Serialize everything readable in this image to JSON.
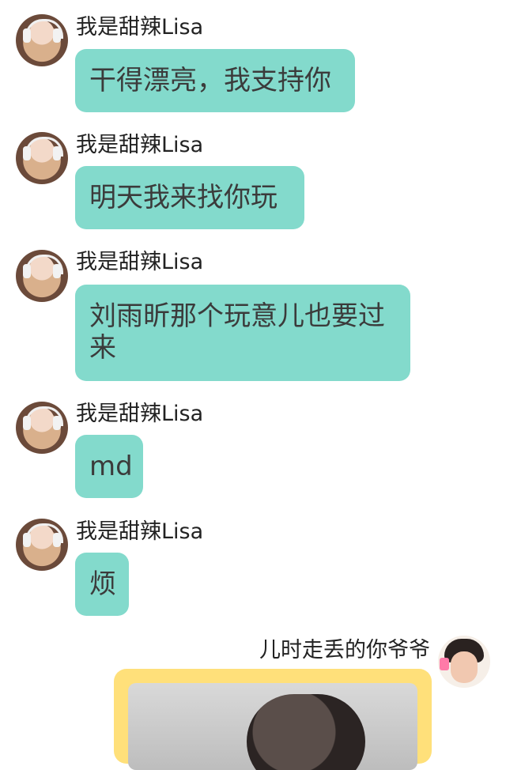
{
  "chat": {
    "incoming": [
      {
        "sender": "我是甜辣Lisa",
        "text": "干得漂亮，我支持你"
      },
      {
        "sender": "我是甜辣Lisa",
        "text": "明天我来找你玩"
      },
      {
        "sender": "我是甜辣Lisa",
        "text": "刘雨昕那个玩意儿也要过来"
      },
      {
        "sender": "我是甜辣Lisa",
        "text": "md"
      },
      {
        "sender": "我是甜辣Lisa",
        "text": "烦"
      }
    ],
    "outgoing": {
      "sender": "儿时走丢的你爷爷"
    }
  }
}
